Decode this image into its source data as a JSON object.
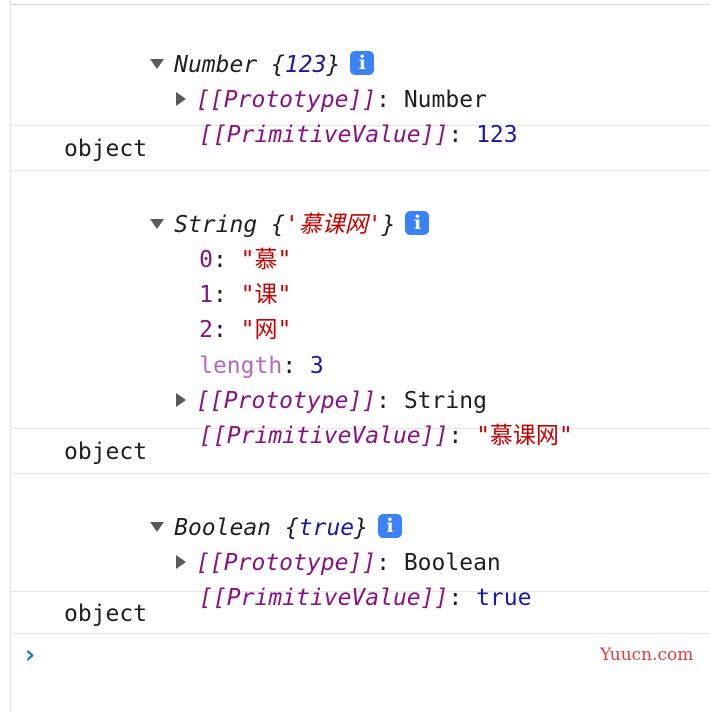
{
  "entries": {
    "number": {
      "type": "Number",
      "open_brace": "{",
      "value": "123",
      "close_brace": "}",
      "info_icon": "i",
      "proto_key": "[[Prototype]]",
      "proto_value": "Number",
      "prim_key": "[[PrimitiveValue]]",
      "prim_value": "123"
    },
    "typeof1": "object",
    "string": {
      "type": "String",
      "open_brace": "{",
      "value": "'慕课网'",
      "close_brace": "}",
      "info_icon": "i",
      "items": [
        {
          "key": "0",
          "value": "\"慕\""
        },
        {
          "key": "1",
          "value": "\"课\""
        },
        {
          "key": "2",
          "value": "\"网\""
        }
      ],
      "length_key": "length",
      "length_value": "3",
      "proto_key": "[[Prototype]]",
      "proto_value": "String",
      "prim_key": "[[PrimitiveValue]]",
      "prim_value": "\"慕课网\""
    },
    "typeof2": "object",
    "boolean": {
      "type": "Boolean",
      "open_brace": "{",
      "value": "true",
      "close_brace": "}",
      "info_icon": "i",
      "proto_key": "[[Prototype]]",
      "proto_value": "Boolean",
      "prim_key": "[[PrimitiveValue]]",
      "prim_value": "true"
    },
    "typeof3": "object"
  },
  "prompt_icon": "chevron-right-icon",
  "prompt_glyph": "›",
  "colon": ":",
  "watermark": "Yuucn.com"
}
